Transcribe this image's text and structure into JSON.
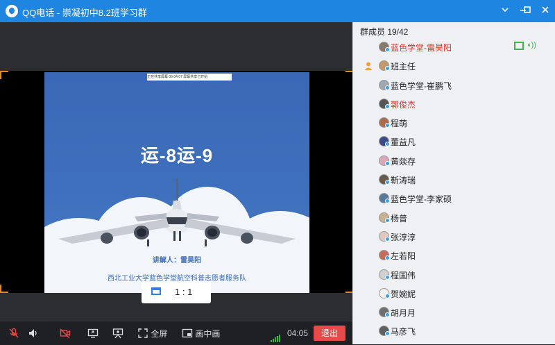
{
  "window": {
    "title": "QQ电话 - 崇凝初中8.2班学习群"
  },
  "slide": {
    "topbar_text": "正在共享屏幕  06:04:07   屏幕共享已开始",
    "title": "运-8运-9",
    "speaker": "讲解人：雷昊阳",
    "org": "西北工业大学蓝色学堂航空科普志愿者服务队"
  },
  "view": {
    "ratio_label": "1 : 1"
  },
  "controls": {
    "fullscreen_label": "全屏",
    "pip_label": "画中画",
    "call_time": "04:05",
    "exit_label": "退出"
  },
  "members": {
    "header": "群成员 19/42",
    "list": [
      {
        "name": "蓝色学堂-雷昊阳",
        "highlight": true,
        "avatar_color": "#8a7a6a"
      },
      {
        "name": "班主任",
        "highlight": false,
        "avatar_color": "#c49a6c"
      },
      {
        "name": "蓝色学堂-崔鹏飞",
        "highlight": false,
        "avatar_color": "#a0a8b0"
      },
      {
        "name": "郭俊杰",
        "highlight": true,
        "avatar_color": "#555555"
      },
      {
        "name": "程萌",
        "highlight": false,
        "avatar_color": "#b06a4a"
      },
      {
        "name": "董益凡",
        "highlight": false,
        "avatar_color": "#3a4a8a"
      },
      {
        "name": "黄燚存",
        "highlight": false,
        "avatar_color": "#d8a8b8"
      },
      {
        "name": "靳涛瑞",
        "highlight": false,
        "avatar_color": "#6a5a4a"
      },
      {
        "name": "蓝色学堂-李家硕",
        "highlight": false,
        "avatar_color": "#5a7a9a"
      },
      {
        "name": "杨普",
        "highlight": false,
        "avatar_color": "#c8b090"
      },
      {
        "name": "张淳淳",
        "highlight": false,
        "avatar_color": "#e0c8c0"
      },
      {
        "name": "左若阳",
        "highlight": false,
        "avatar_color": "#c86a5a"
      },
      {
        "name": "程国伟",
        "highlight": false,
        "avatar_color": "#d0d0d0"
      },
      {
        "name": "贺婉妮",
        "highlight": false,
        "avatar_color": "#f0f0f0"
      },
      {
        "name": "胡月月",
        "highlight": false,
        "avatar_color": "#707070"
      },
      {
        "name": "马彦飞",
        "highlight": false,
        "avatar_color": "#606060"
      }
    ]
  },
  "colors": {
    "titlebar": "#1e85e0",
    "accent_red": "#e0302a",
    "speaking_green": "#3bb54a",
    "exit_red": "#e84a4a"
  },
  "icons": {
    "app": "qq-logo-icon",
    "mic": "mic-muted-icon",
    "speaker": "speaker-icon",
    "camera": "camera-off-icon",
    "share": "screen-share-icon",
    "present": "present-icon",
    "fullscreen": "fullscreen-icon",
    "pip": "picture-in-picture-icon"
  }
}
